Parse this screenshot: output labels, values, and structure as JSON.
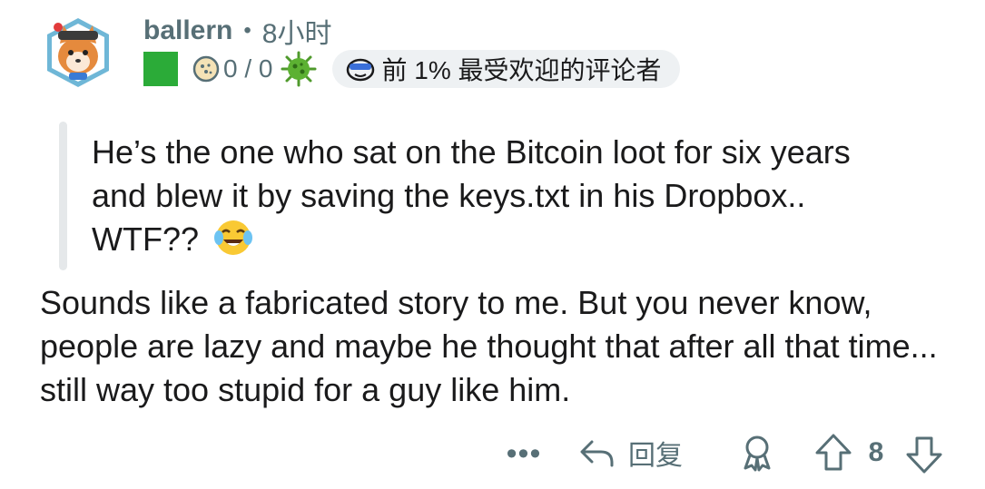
{
  "comment": {
    "username": "ballern",
    "separator": "•",
    "time_ago": "8小时",
    "karma_text": "0 / 0",
    "badge_text": "前 1% 最受欢迎的评论者",
    "quote": "He’s the one who sat on the Bitcoin loot for six years and blew it by saving the keys.txt in his Dropbox.. WTF??",
    "quote_emoji": "face-with-tears-of-joy",
    "body": "Sounds like a fabricated story to me. But you never know, people are lazy and maybe he thought that after all that time... still way too stupid for a guy like him."
  },
  "actions": {
    "more_label": "•••",
    "reply_label": "回复",
    "score": "8"
  },
  "colors": {
    "meta_gray": "#576f76",
    "text": "#1a1a1b",
    "flair_green": "#2bab38",
    "badge_bg": "#eef1f3",
    "quote_bar": "#e5e8ea"
  }
}
